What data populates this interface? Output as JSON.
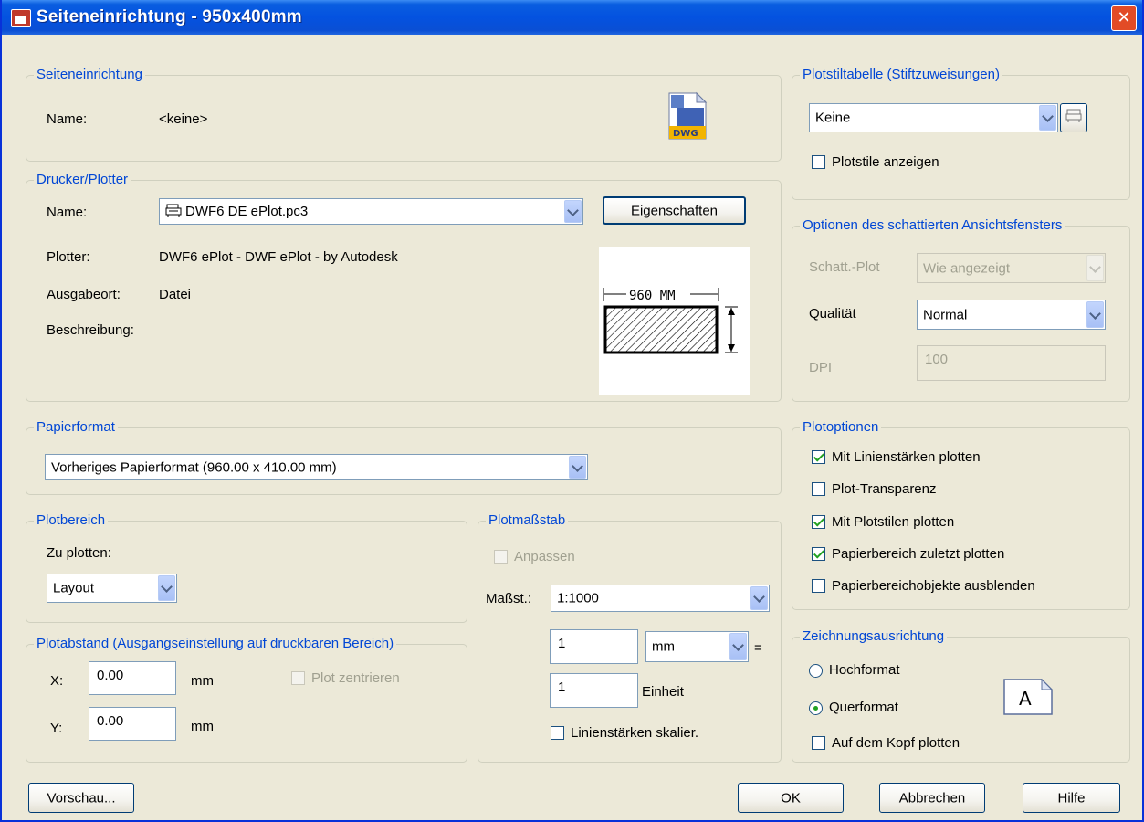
{
  "window": {
    "title": "Seiteneinrichtung - 950x400mm",
    "close": "✕"
  },
  "seiteneinrichtung": {
    "legend": "Seiteneinrichtung",
    "name_label": "Name:",
    "name_value": "<keine>",
    "icon_text": "DWG"
  },
  "drucker": {
    "legend": "Drucker/Plotter",
    "name_label": "Name:",
    "name_value": "DWF6 DE ePlot.pc3",
    "properties_button": "Eigenschaften",
    "plotter_label": "Plotter:",
    "plotter_value": "DWF6 ePlot - DWF ePlot - by Autodesk",
    "ausgabeort_label": "Ausgabeort:",
    "ausgabeort_value": "Datei",
    "beschreibung_label": "Beschreibung:",
    "preview_dim": "960 MM"
  },
  "papierformat": {
    "legend": "Papierformat",
    "value": "Vorheriges Papierformat  (960.00 x 410.00 mm)"
  },
  "plotbereich": {
    "legend": "Plotbereich",
    "label": "Zu plotten:",
    "value": "Layout"
  },
  "plotabstand": {
    "legend": "Plotabstand (Ausgangseinstellung auf druckbaren Bereich)",
    "x_label": "X:",
    "x_value": "0.00",
    "x_unit": "mm",
    "y_label": "Y:",
    "y_value": "0.00",
    "y_unit": "mm",
    "center_label": "Plot zentrieren"
  },
  "plotmassstab": {
    "legend": "Plotmaßstab",
    "fit_label": "Anpassen",
    "scale_label": "Maßst.:",
    "scale_value": "1:1000",
    "num_value": "1",
    "unit_value": "mm",
    "equals": "=",
    "den_value": "1",
    "den_label": "Einheit",
    "lineweights_label": "Linienstärken skalier."
  },
  "plotstiltabelle": {
    "legend": "Plotstiltabelle (Stiftzuweisungen)",
    "value": "Keine",
    "show_label": "Plotstile anzeigen"
  },
  "schattiert": {
    "legend": "Optionen des schattierten Ansichtsfensters",
    "plot_label": "Schatt.-Plot",
    "plot_value": "Wie angezeigt",
    "quality_label": "Qualität",
    "quality_value": "Normal",
    "dpi_label": "DPI",
    "dpi_value": "100"
  },
  "plotoptionen": {
    "legend": "Plotoptionen",
    "items": [
      {
        "label": "Mit Linienstärken plotten",
        "checked": true
      },
      {
        "label": "Plot-Transparenz",
        "checked": false
      },
      {
        "label": "Mit Plotstilen plotten",
        "checked": true
      },
      {
        "label": "Papierbereich zuletzt plotten",
        "checked": true
      },
      {
        "label": "Papierbereichobjekte ausblenden",
        "checked": false
      }
    ]
  },
  "ausrichtung": {
    "legend": "Zeichnungsausrichtung",
    "hoch": "Hochformat",
    "quer": "Querformat",
    "kopf": "Auf dem Kopf plotten",
    "icon_letter": "A"
  },
  "buttons": {
    "preview": "Vorschau...",
    "ok": "OK",
    "cancel": "Abbrechen",
    "help": "Hilfe"
  }
}
